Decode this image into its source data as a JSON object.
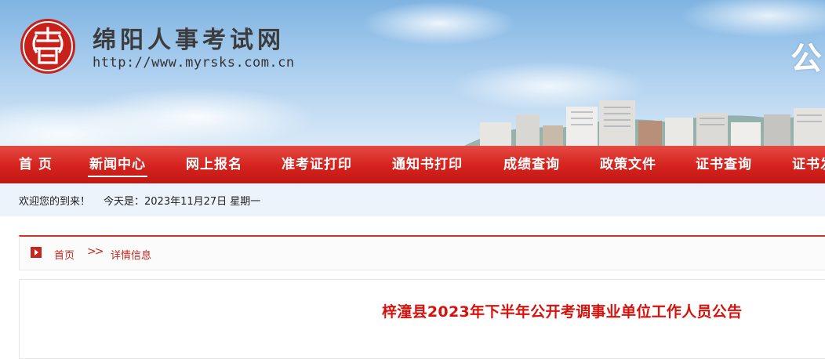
{
  "header": {
    "site_name": "绵阳人事考试网",
    "site_url": "http://www.myrsks.com.cn",
    "banner_partial_text": "公"
  },
  "nav": {
    "items": [
      {
        "label": "首  页"
      },
      {
        "label": "新闻中心",
        "active": true
      },
      {
        "label": "网上报名"
      },
      {
        "label": "准考证打印"
      },
      {
        "label": "通知书打印"
      },
      {
        "label": "成绩查询"
      },
      {
        "label": "政策文件"
      },
      {
        "label": "证书查询"
      },
      {
        "label": "证书发"
      }
    ]
  },
  "welcome": {
    "greeting": "欢迎您的到来！",
    "date": "今天是：2023年11月27日 星期一"
  },
  "breadcrumb": {
    "home": "首页",
    "separator": ">>",
    "current": "详情信息"
  },
  "article": {
    "title": "梓潼县2023年下半年公开考调事业单位工作人员公告"
  },
  "colors": {
    "nav_red": "#d5221d",
    "title_red": "#d7120c",
    "welcome_bg": "#ecf3fb"
  },
  "icons": [
    "seal-logo-icon",
    "breadcrumb-play-icon"
  ]
}
